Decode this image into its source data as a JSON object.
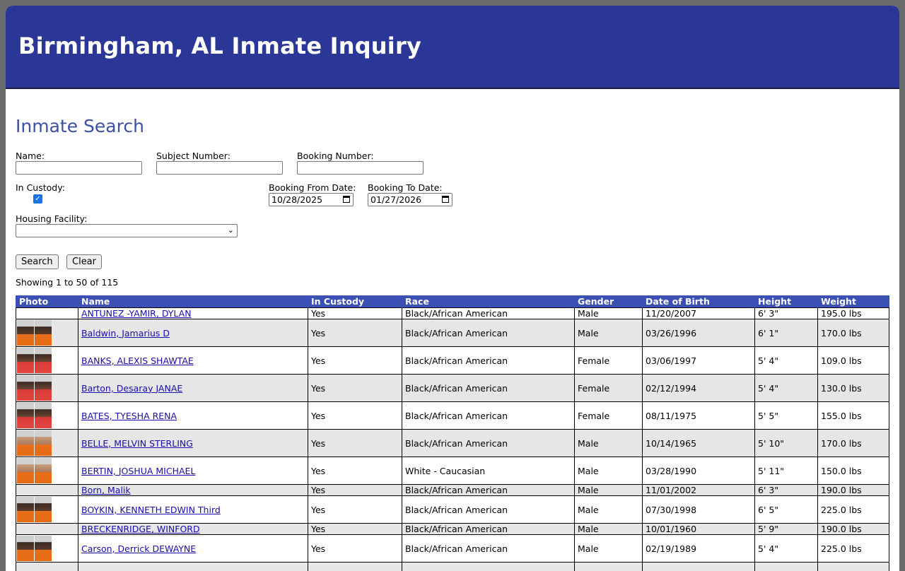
{
  "header": {
    "title": "Birmingham, AL Inmate Inquiry"
  },
  "search": {
    "title": "Inmate Search",
    "name_label": "Name:",
    "name_value": "",
    "subject_label": "Subject Number:",
    "subject_value": "",
    "booking_label": "Booking Number:",
    "booking_value": "",
    "custody_label": "In Custody:",
    "custody_checked": true,
    "from_label": "Booking From Date:",
    "from_value": "10/28/2025",
    "to_label": "Booking To Date:",
    "to_value": "01/27/2026",
    "facility_label": "Housing Facility:",
    "facility_value": "",
    "search_button": "Search",
    "clear_button": "Clear"
  },
  "results": {
    "showing": "Showing 1 to 50 of 115",
    "columns": [
      "Photo",
      "Name",
      "In Custody",
      "Race",
      "Gender",
      "Date of Birth",
      "Height",
      "Weight"
    ],
    "rows": [
      {
        "photo": false,
        "name": "ANTUNEZ -YAMIR, DYLAN",
        "custody": "Yes",
        "race": "Black/African American",
        "gender": "Male",
        "dob": "11/20/2007",
        "height": "6' 3\"",
        "weight": "195.0 lbs"
      },
      {
        "photo": true,
        "tone": "dk",
        "name": "Baldwin, Jamarius D",
        "custody": "Yes",
        "race": "Black/African American",
        "gender": "Male",
        "dob": "03/26/1996",
        "height": "6' 1\"",
        "weight": "170.0 lbs"
      },
      {
        "photo": true,
        "tone": "rd",
        "name": "BANKS, ALEXIS SHAWTAE",
        "custody": "Yes",
        "race": "Black/African American",
        "gender": "Female",
        "dob": "03/06/1997",
        "height": "5' 4\"",
        "weight": "109.0 lbs"
      },
      {
        "photo": true,
        "tone": "rd",
        "name": "Barton, Desaray JANAE",
        "custody": "Yes",
        "race": "Black/African American",
        "gender": "Female",
        "dob": "02/12/1994",
        "height": "5' 4\"",
        "weight": "130.0 lbs"
      },
      {
        "photo": true,
        "tone": "rd",
        "name": "BATES, TYESHA RENA",
        "custody": "Yes",
        "race": "Black/African American",
        "gender": "Female",
        "dob": "08/11/1975",
        "height": "5' 5\"",
        "weight": "155.0 lbs"
      },
      {
        "photo": true,
        "tone": "lt",
        "name": "BELLE, MELVIN STERLING",
        "custody": "Yes",
        "race": "Black/African American",
        "gender": "Male",
        "dob": "10/14/1965",
        "height": "5' 10\"",
        "weight": "170.0 lbs"
      },
      {
        "photo": true,
        "tone": "lt",
        "name": "BERTIN, JOSHUA MICHAEL",
        "custody": "Yes",
        "race": "White - Caucasian",
        "gender": "Male",
        "dob": "03/28/1990",
        "height": "5' 11\"",
        "weight": "150.0 lbs"
      },
      {
        "photo": false,
        "name": "Born, Malik",
        "custody": "Yes",
        "race": "Black/African American",
        "gender": "Male",
        "dob": "11/01/2002",
        "height": "6' 3\"",
        "weight": "190.0 lbs"
      },
      {
        "photo": true,
        "tone": "dk",
        "name": "BOYKIN, KENNETH EDWIN Third",
        "custody": "Yes",
        "race": "Black/African American",
        "gender": "Male",
        "dob": "07/30/1998",
        "height": "6' 5\"",
        "weight": "225.0 lbs"
      },
      {
        "photo": false,
        "name": "BRECKENRIDGE, WINFORD",
        "custody": "Yes",
        "race": "Black/African American",
        "gender": "Male",
        "dob": "10/01/1960",
        "height": "5' 9\"",
        "weight": "190.0 lbs"
      },
      {
        "photo": true,
        "tone": "dk",
        "name": "Carson, Derrick DEWAYNE",
        "custody": "Yes",
        "race": "Black/African American",
        "gender": "Male",
        "dob": "02/19/1989",
        "height": "5' 4\"",
        "weight": "225.0 lbs"
      },
      {
        "photo": false,
        "name": "",
        "custody": "",
        "race": "",
        "gender": "",
        "dob": "",
        "height": "",
        "weight": ""
      }
    ]
  }
}
